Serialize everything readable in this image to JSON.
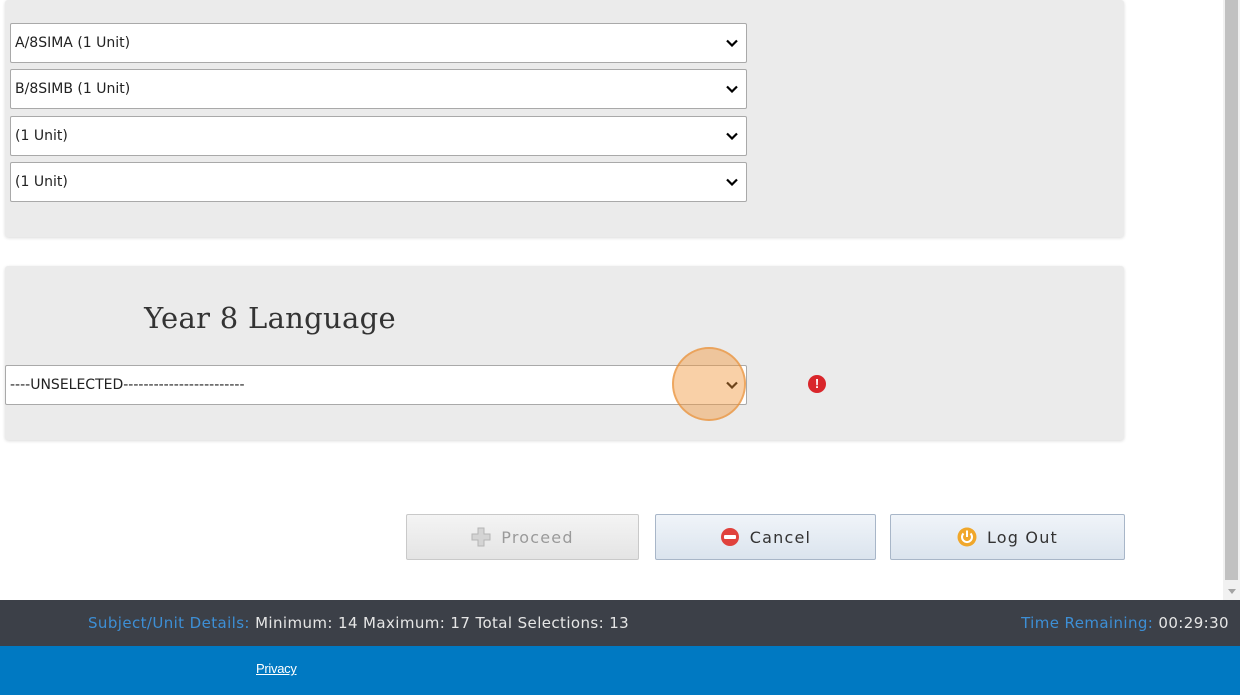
{
  "units_panel": {
    "selects": [
      {
        "value": "A/8SIMA (1 Unit)"
      },
      {
        "value": "B/8SIMB (1 Unit)"
      },
      {
        "value": "(1 Unit)"
      },
      {
        "value": "(1 Unit)"
      }
    ]
  },
  "language_panel": {
    "title": "Year 8 Language",
    "select_value": "----UNSELECTED------------------------",
    "error_glyph": "!"
  },
  "actions": {
    "proceed_label": "Proceed",
    "cancel_label": "Cancel",
    "logout_label": "Log Out"
  },
  "status_bar": {
    "details_label": "Subject/Unit Details:",
    "details_value": "Minimum: 14 Maximum: 17 Total Selections: 13",
    "time_label": "Time Remaining:",
    "time_value": "00:29:30"
  },
  "footer": {
    "privacy_link": "Privacy"
  },
  "colors": {
    "status_bar_bg": "#3c4048",
    "footer_bg": "#0079c2",
    "status_label_blue": "#3d8fd6",
    "error_red": "#d9262b",
    "highlight_orange": "#f1963c"
  },
  "icons": {
    "chevron": "chevron-down-icon",
    "error": "error-icon",
    "proceed": "plus-icon",
    "cancel": "no-entry-icon",
    "logout": "power-icon"
  }
}
